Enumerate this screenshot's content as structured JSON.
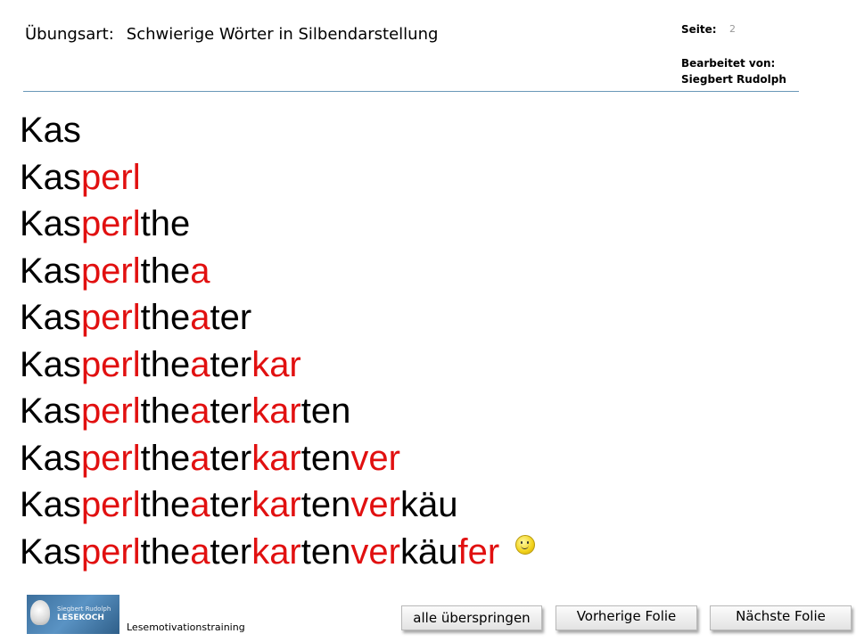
{
  "header": {
    "exercise_label": "Übungsart:",
    "exercise_value": "Schwierige Wörter in Silbendarstellung",
    "page_label": "Seite:",
    "page_number": "2",
    "edited_by_label": "Bearbeitet von:",
    "edited_by_name": "Siegbert Rudolph"
  },
  "words": [
    [
      [
        "Kas",
        "black"
      ]
    ],
    [
      [
        "Kas",
        "black"
      ],
      [
        "perl",
        "red"
      ]
    ],
    [
      [
        "Kas",
        "black"
      ],
      [
        "perl",
        "red"
      ],
      [
        "the",
        "black"
      ]
    ],
    [
      [
        "Kas",
        "black"
      ],
      [
        "perl",
        "red"
      ],
      [
        "the",
        "black"
      ],
      [
        "a",
        "red"
      ]
    ],
    [
      [
        "Kas",
        "black"
      ],
      [
        "perl",
        "red"
      ],
      [
        "the",
        "black"
      ],
      [
        "a",
        "red"
      ],
      [
        "ter",
        "black"
      ]
    ],
    [
      [
        "Kas",
        "black"
      ],
      [
        "perl",
        "red"
      ],
      [
        "the",
        "black"
      ],
      [
        "a",
        "red"
      ],
      [
        "ter",
        "black"
      ],
      [
        "kar",
        "red"
      ]
    ],
    [
      [
        "Kas",
        "black"
      ],
      [
        "perl",
        "red"
      ],
      [
        "the",
        "black"
      ],
      [
        "a",
        "red"
      ],
      [
        "ter",
        "black"
      ],
      [
        "kar",
        "red"
      ],
      [
        "ten",
        "black"
      ]
    ],
    [
      [
        "Kas",
        "black"
      ],
      [
        "perl",
        "red"
      ],
      [
        "the",
        "black"
      ],
      [
        "a",
        "red"
      ],
      [
        "ter",
        "black"
      ],
      [
        "kar",
        "red"
      ],
      [
        "ten",
        "black"
      ],
      [
        "ver",
        "red"
      ]
    ],
    [
      [
        "Kas",
        "black"
      ],
      [
        "perl",
        "red"
      ],
      [
        "the",
        "black"
      ],
      [
        "a",
        "red"
      ],
      [
        "ter",
        "black"
      ],
      [
        "kar",
        "red"
      ],
      [
        "ten",
        "black"
      ],
      [
        "ver",
        "red"
      ],
      [
        "käu",
        "black"
      ]
    ],
    [
      [
        "Kas",
        "black"
      ],
      [
        "perl",
        "red"
      ],
      [
        "the",
        "black"
      ],
      [
        "a",
        "red"
      ],
      [
        "ter",
        "black"
      ],
      [
        "kar",
        "red"
      ],
      [
        "ten",
        "black"
      ],
      [
        "ver",
        "red"
      ],
      [
        "käu",
        "black"
      ],
      [
        "fer",
        "red"
      ]
    ]
  ],
  "colors": {
    "red": "#e11010",
    "black": "#000000",
    "rule": "#6a98b8"
  },
  "icons": {
    "smiley": "smiley-icon",
    "logo": "lesekoch-logo"
  },
  "footer": {
    "logo_small_text": "Siegbert Rudolph",
    "logo_brand_text": "LESEKOCH",
    "training_label": "Lesemotivationstraining"
  },
  "nav": {
    "skip_all": "alle überspringen",
    "previous": "Vorherige Folie",
    "next": "Nächste Folie"
  }
}
